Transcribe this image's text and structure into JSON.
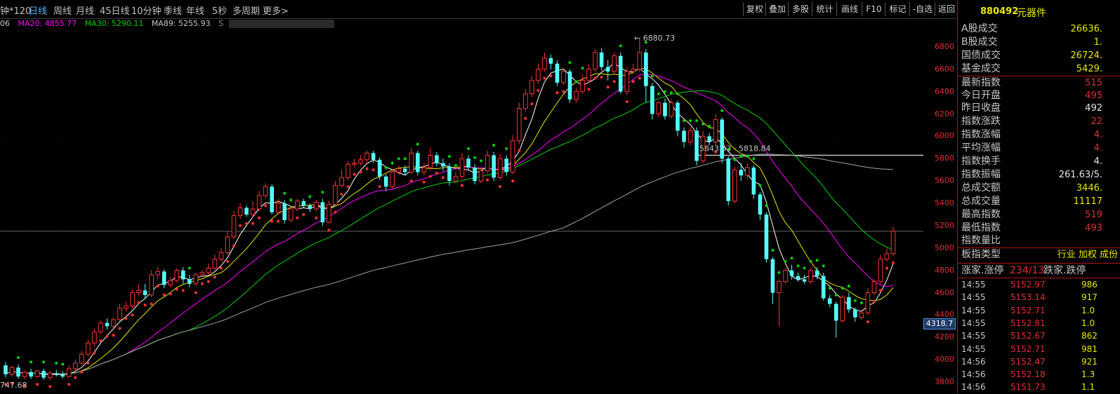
{
  "periods": [
    "钟*120",
    "日线",
    "周线",
    "月线",
    "45日线",
    "10分钟",
    "季线",
    "年线",
    "5秒",
    "多周期",
    "更多>"
  ],
  "active_period": "日线",
  "toolbar": [
    "复权",
    "叠加",
    "多股",
    "统计",
    "画线",
    "F10",
    "标记",
    "-自选",
    "返回"
  ],
  "ma_bar": {
    "prefix": "06",
    "ma20": "MA20: 4855.77",
    "ma30": "MA30: 5290.11",
    "ma89": "MA89: 5255.93",
    "blurred": "S"
  },
  "labels": {
    "high": "6880.73",
    "low": "747.68",
    "hline": "5843.53 · 5818.84",
    "current": "4318.7"
  },
  "panel": {
    "code": "880492",
    "name": "元器件",
    "rows": [
      {
        "label": "A股成交",
        "value": "26636.",
        "color": "yellow"
      },
      {
        "label": "B股成交",
        "value": "1.",
        "color": "yellow"
      },
      {
        "label": "国债成交",
        "value": "26724.",
        "color": "yellow"
      },
      {
        "label": "基金成交",
        "value": "5429.",
        "color": "yellow"
      },
      {
        "label": "最新指数",
        "value": "515",
        "color": "red"
      },
      {
        "label": "今日开盘",
        "value": "495",
        "color": "red"
      },
      {
        "label": "昨日收盘",
        "value": "492",
        "color": "white"
      },
      {
        "label": "指数涨跌",
        "value": "22",
        "color": "red"
      },
      {
        "label": "指数涨幅",
        "value": "4.",
        "color": "red"
      },
      {
        "label": "平均涨幅",
        "value": "4.",
        "color": "red"
      },
      {
        "label": "指数换手",
        "value": "4.",
        "color": "white"
      },
      {
        "label": "指数振幅",
        "value": "261.63/5.",
        "color": "white"
      },
      {
        "label": "总成交额",
        "value": "3446.",
        "color": "yellow"
      },
      {
        "label": "总成交量",
        "value": "11117",
        "color": "yellow"
      },
      {
        "label": "最高指数",
        "value": "519",
        "color": "red"
      },
      {
        "label": "最低指数",
        "value": "493",
        "color": "red"
      },
      {
        "label": "指数量比",
        "value": "",
        "color": "white"
      },
      {
        "label": "板指类型",
        "value": "行业 加权 成份",
        "color": "yellow"
      }
    ],
    "limit_row": {
      "up_label": "涨家.涨停",
      "up_value": "234/13",
      "down_label": "跌家.跌停"
    },
    "ticks": [
      [
        "14:55",
        "5152.97",
        "986"
      ],
      [
        "14:55",
        "5153.14",
        "917"
      ],
      [
        "14:55",
        "5152.71",
        "1.0"
      ],
      [
        "14:55",
        "5152.81",
        "1.0"
      ],
      [
        "14:55",
        "5152.67",
        "862"
      ],
      [
        "14:55",
        "5152.71",
        "981"
      ],
      [
        "14:56",
        "5152.47",
        "921"
      ],
      [
        "14:56",
        "5152.18",
        "1.3"
      ],
      [
        "14:56",
        "5151.73",
        "1.1"
      ]
    ]
  },
  "colors": {
    "up": "#ff3232",
    "down": "#54ffff",
    "ma5": "#ffffff",
    "ma10": "#e6e600",
    "ma20": "#ff00ff",
    "ma30": "#00d000",
    "ma89": "#a0a0a0",
    "sar_up": "#ff3232",
    "sar_down": "#00d000"
  },
  "chart_data": {
    "type": "candlestick",
    "y_range": [
      3700,
      6950
    ],
    "y_ticks": [
      3800,
      4000,
      4200,
      4400,
      4600,
      4800,
      5000,
      5200,
      5400,
      5600,
      5800,
      6000,
      6200,
      6400,
      6600,
      6800
    ],
    "candles": [
      [
        3950,
        3870,
        3980,
        3840
      ],
      [
        3870,
        3930,
        3950,
        3850
      ],
      [
        3930,
        3850,
        3960,
        3830
      ],
      [
        3850,
        3890,
        3900,
        3830
      ],
      [
        3890,
        3850,
        3920,
        3830
      ],
      [
        3850,
        3900,
        3910,
        3840
      ],
      [
        3900,
        3840,
        3920,
        3820
      ],
      [
        3840,
        3880,
        3900,
        3820
      ],
      [
        3880,
        3870,
        3910,
        3850
      ],
      [
        3870,
        3850,
        3900,
        3830
      ],
      [
        3850,
        3920,
        3950,
        3840
      ],
      [
        3920,
        3970,
        4000,
        3900
      ],
      [
        3970,
        4050,
        4080,
        3950
      ],
      [
        4050,
        4150,
        4180,
        4030
      ],
      [
        4150,
        4250,
        4280,
        4120
      ],
      [
        4250,
        4330,
        4350,
        4230
      ],
      [
        4330,
        4300,
        4370,
        4270
      ],
      [
        4300,
        4360,
        4380,
        4280
      ],
      [
        4360,
        4460,
        4500,
        4340
      ],
      [
        4460,
        4480,
        4520,
        4430
      ],
      [
        4480,
        4600,
        4630,
        4460
      ],
      [
        4600,
        4620,
        4680,
        4570
      ],
      [
        4620,
        4580,
        4680,
        4550
      ],
      [
        4580,
        4760,
        4800,
        4560
      ],
      [
        4760,
        4790,
        4830,
        4720
      ],
      [
        4790,
        4670,
        4810,
        4640
      ],
      [
        4670,
        4710,
        4740,
        4650
      ],
      [
        4710,
        4800,
        4820,
        4690
      ],
      [
        4800,
        4720,
        4830,
        4680
      ],
      [
        4720,
        4680,
        4760,
        4650
      ],
      [
        4680,
        4760,
        4780,
        4660
      ],
      [
        4760,
        4780,
        4800,
        4740
      ],
      [
        4780,
        4820,
        4860,
        4760
      ],
      [
        4820,
        4900,
        4940,
        4800
      ],
      [
        4900,
        4960,
        5000,
        4880
      ],
      [
        4960,
        5100,
        5150,
        4940
      ],
      [
        5100,
        5290,
        5330,
        5080
      ],
      [
        5290,
        5360,
        5400,
        5260
      ],
      [
        5360,
        5300,
        5380,
        5280
      ],
      [
        5300,
        5350,
        5420,
        5280
      ],
      [
        5350,
        5470,
        5510,
        5330
      ],
      [
        5470,
        5550,
        5580,
        5440
      ],
      [
        5550,
        5320,
        5570,
        5300
      ],
      [
        5320,
        5400,
        5440,
        5300
      ],
      [
        5400,
        5250,
        5430,
        5220
      ],
      [
        5250,
        5350,
        5370,
        5230
      ],
      [
        5350,
        5420,
        5440,
        5330
      ],
      [
        5420,
        5380,
        5440,
        5360
      ],
      [
        5380,
        5350,
        5400,
        5320
      ],
      [
        5350,
        5410,
        5430,
        5330
      ],
      [
        5410,
        5230,
        5440,
        5200
      ],
      [
        5230,
        5390,
        5420,
        5220
      ],
      [
        5390,
        5560,
        5600,
        5380
      ],
      [
        5560,
        5630,
        5700,
        5540
      ],
      [
        5630,
        5750,
        5780,
        5610
      ],
      [
        5750,
        5760,
        5800,
        5720
      ],
      [
        5760,
        5790,
        5830,
        5740
      ],
      [
        5790,
        5850,
        5870,
        5770
      ],
      [
        5850,
        5790,
        5870,
        5760
      ],
      [
        5790,
        5640,
        5810,
        5610
      ],
      [
        5640,
        5550,
        5660,
        5510
      ],
      [
        5550,
        5680,
        5700,
        5530
      ],
      [
        5680,
        5710,
        5740,
        5660
      ],
      [
        5710,
        5680,
        5740,
        5650
      ],
      [
        5680,
        5850,
        5900,
        5660
      ],
      [
        5850,
        5680,
        5870,
        5650
      ],
      [
        5680,
        5720,
        5760,
        5650
      ],
      [
        5720,
        5830,
        5900,
        5700
      ],
      [
        5830,
        5760,
        5860,
        5730
      ],
      [
        5760,
        5730,
        5800,
        5690
      ],
      [
        5730,
        5600,
        5760,
        5560
      ],
      [
        5600,
        5640,
        5680,
        5580
      ],
      [
        5640,
        5800,
        5850,
        5620
      ],
      [
        5800,
        5720,
        5830,
        5700
      ],
      [
        5720,
        5600,
        5750,
        5570
      ],
      [
        5600,
        5690,
        5720,
        5580
      ],
      [
        5690,
        5830,
        5870,
        5670
      ],
      [
        5830,
        5630,
        5860,
        5600
      ],
      [
        5630,
        5800,
        5840,
        5610
      ],
      [
        5800,
        5680,
        5830,
        5650
      ],
      [
        5680,
        5960,
        6010,
        5660
      ],
      [
        5960,
        6250,
        6300,
        5930
      ],
      [
        6250,
        6380,
        6420,
        6220
      ],
      [
        6380,
        6500,
        6540,
        6350
      ],
      [
        6500,
        6600,
        6650,
        6470
      ],
      [
        6600,
        6700,
        6750,
        6580
      ],
      [
        6700,
        6650,
        6730,
        6600
      ],
      [
        6650,
        6480,
        6680,
        6450
      ],
      [
        6480,
        6580,
        6610,
        6460
      ],
      [
        6580,
        6330,
        6600,
        6300
      ],
      [
        6330,
        6400,
        6430,
        6300
      ],
      [
        6400,
        6500,
        6550,
        6380
      ],
      [
        6500,
        6600,
        6650,
        6480
      ],
      [
        6600,
        6750,
        6780,
        6580
      ],
      [
        6750,
        6620,
        6790,
        6590
      ],
      [
        6620,
        6580,
        6680,
        6500
      ],
      [
        6580,
        6720,
        6750,
        6550
      ],
      [
        6720,
        6400,
        6750,
        6380
      ],
      [
        6400,
        6580,
        6620,
        6370
      ],
      [
        6580,
        6600,
        6650,
        6550
      ],
      [
        6600,
        6750,
        6880,
        6580
      ],
      [
        6750,
        6450,
        6780,
        6300
      ],
      [
        6450,
        6200,
        6480,
        6150
      ],
      [
        6200,
        6300,
        6320,
        6170
      ],
      [
        6300,
        6180,
        6340,
        6150
      ],
      [
        6180,
        6300,
        6330,
        6160
      ],
      [
        6300,
        6050,
        6320,
        6000
      ],
      [
        6050,
        5950,
        6080,
        5900
      ],
      [
        5950,
        6050,
        6080,
        5920
      ],
      [
        6050,
        5780,
        6080,
        5740
      ],
      [
        5780,
        6000,
        6050,
        5760
      ],
      [
        6000,
        5950,
        6030,
        5920
      ],
      [
        5950,
        6150,
        6200,
        5920
      ],
      [
        6150,
        5800,
        6170,
        5760
      ],
      [
        5800,
        5420,
        5820,
        5380
      ],
      [
        5420,
        5700,
        5730,
        5400
      ],
      [
        5700,
        5650,
        5760,
        5600
      ],
      [
        5650,
        5720,
        5760,
        5620
      ],
      [
        5720,
        5480,
        5740,
        5440
      ],
      [
        5480,
        5300,
        5500,
        5250
      ],
      [
        5300,
        4900,
        5320,
        4870
      ],
      [
        4900,
        4600,
        4920,
        4500
      ],
      [
        4600,
        4700,
        4720,
        4300
      ],
      [
        4700,
        4800,
        4820,
        4680
      ],
      [
        4800,
        4750,
        4850,
        4720
      ],
      [
        4750,
        4720,
        4780,
        4700
      ],
      [
        4720,
        4700,
        4760,
        4680
      ],
      [
        4700,
        4800,
        4820,
        4680
      ],
      [
        4800,
        4750,
        4830,
        4720
      ],
      [
        4750,
        4550,
        4780,
        4530
      ],
      [
        4550,
        4500,
        4580,
        4470
      ],
      [
        4500,
        4350,
        4520,
        4200
      ],
      [
        4350,
        4560,
        4580,
        4330
      ],
      [
        4560,
        4450,
        4600,
        4420
      ],
      [
        4450,
        4380,
        4470,
        4340
      ],
      [
        4380,
        4420,
        4450,
        4360
      ],
      [
        4420,
        4600,
        4640,
        4400
      ],
      [
        4600,
        4700,
        4720,
        4580
      ],
      [
        4700,
        4900,
        4940,
        4680
      ],
      [
        4900,
        4950,
        5000,
        4880
      ],
      [
        4950,
        5150,
        5190,
        4930
      ]
    ]
  }
}
